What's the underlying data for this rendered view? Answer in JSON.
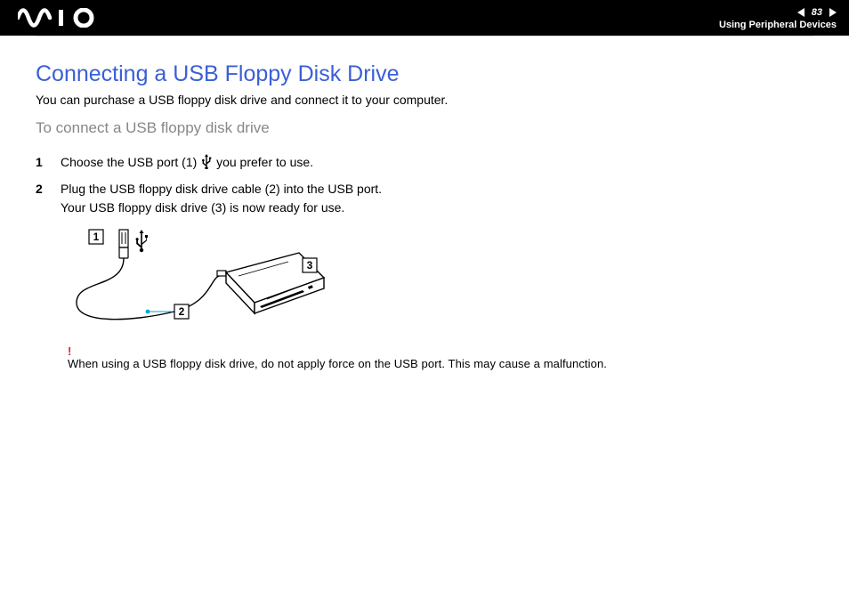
{
  "header": {
    "page_number": "83",
    "section": "Using Peripheral Devices"
  },
  "title": "Connecting a USB Floppy Disk Drive",
  "intro": "You can purchase a USB floppy disk drive and connect it to your computer.",
  "subheading": "To connect a USB floppy disk drive",
  "steps": [
    {
      "num": "1",
      "before_icon": "Choose the USB port (1) ",
      "after_icon": " you prefer to use."
    },
    {
      "num": "2",
      "line1": "Plug the USB floppy disk drive cable (2) into the USB port.",
      "line2": "Your USB floppy disk drive (3) is now ready for use."
    }
  ],
  "diagram": {
    "callout_1": "1",
    "callout_2": "2",
    "callout_3": "3"
  },
  "caution": {
    "mark": "!",
    "text": "When using a USB floppy disk drive, do not apply force on the USB port. This may cause a malfunction."
  }
}
